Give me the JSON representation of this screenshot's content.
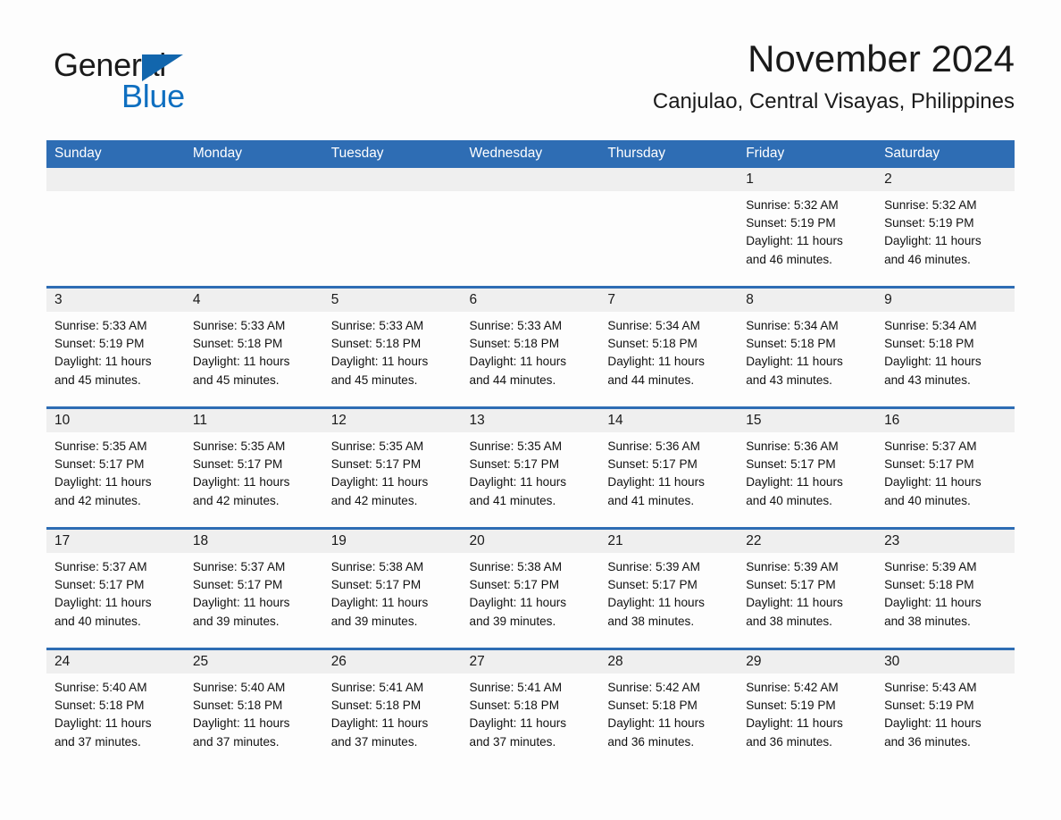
{
  "logo": {
    "word_one": "General",
    "word_two": "Blue",
    "triangle_color": "#1266ad",
    "blue_color": "#0f6fc0"
  },
  "header": {
    "month_title": "November 2024",
    "location": "Canjulao, Central Visayas, Philippines"
  },
  "theme": {
    "header_blue": "#2e6db4",
    "daynum_gray": "#efefef",
    "page_background": "#fdfdfd"
  },
  "weekday_headers": [
    "Sunday",
    "Monday",
    "Tuesday",
    "Wednesday",
    "Thursday",
    "Friday",
    "Saturday"
  ],
  "weeks": [
    [
      {
        "day": "",
        "empty": true
      },
      {
        "day": "",
        "empty": true
      },
      {
        "day": "",
        "empty": true
      },
      {
        "day": "",
        "empty": true
      },
      {
        "day": "",
        "empty": true
      },
      {
        "day": "1",
        "sunrise": "Sunrise: 5:32 AM",
        "sunset": "Sunset: 5:19 PM",
        "daylight_line1": "Daylight: 11 hours",
        "daylight_line2": "and 46 minutes."
      },
      {
        "day": "2",
        "sunrise": "Sunrise: 5:32 AM",
        "sunset": "Sunset: 5:19 PM",
        "daylight_line1": "Daylight: 11 hours",
        "daylight_line2": "and 46 minutes."
      }
    ],
    [
      {
        "day": "3",
        "sunrise": "Sunrise: 5:33 AM",
        "sunset": "Sunset: 5:19 PM",
        "daylight_line1": "Daylight: 11 hours",
        "daylight_line2": "and 45 minutes."
      },
      {
        "day": "4",
        "sunrise": "Sunrise: 5:33 AM",
        "sunset": "Sunset: 5:18 PM",
        "daylight_line1": "Daylight: 11 hours",
        "daylight_line2": "and 45 minutes."
      },
      {
        "day": "5",
        "sunrise": "Sunrise: 5:33 AM",
        "sunset": "Sunset: 5:18 PM",
        "daylight_line1": "Daylight: 11 hours",
        "daylight_line2": "and 45 minutes."
      },
      {
        "day": "6",
        "sunrise": "Sunrise: 5:33 AM",
        "sunset": "Sunset: 5:18 PM",
        "daylight_line1": "Daylight: 11 hours",
        "daylight_line2": "and 44 minutes."
      },
      {
        "day": "7",
        "sunrise": "Sunrise: 5:34 AM",
        "sunset": "Sunset: 5:18 PM",
        "daylight_line1": "Daylight: 11 hours",
        "daylight_line2": "and 44 minutes."
      },
      {
        "day": "8",
        "sunrise": "Sunrise: 5:34 AM",
        "sunset": "Sunset: 5:18 PM",
        "daylight_line1": "Daylight: 11 hours",
        "daylight_line2": "and 43 minutes."
      },
      {
        "day": "9",
        "sunrise": "Sunrise: 5:34 AM",
        "sunset": "Sunset: 5:18 PM",
        "daylight_line1": "Daylight: 11 hours",
        "daylight_line2": "and 43 minutes."
      }
    ],
    [
      {
        "day": "10",
        "sunrise": "Sunrise: 5:35 AM",
        "sunset": "Sunset: 5:17 PM",
        "daylight_line1": "Daylight: 11 hours",
        "daylight_line2": "and 42 minutes."
      },
      {
        "day": "11",
        "sunrise": "Sunrise: 5:35 AM",
        "sunset": "Sunset: 5:17 PM",
        "daylight_line1": "Daylight: 11 hours",
        "daylight_line2": "and 42 minutes."
      },
      {
        "day": "12",
        "sunrise": "Sunrise: 5:35 AM",
        "sunset": "Sunset: 5:17 PM",
        "daylight_line1": "Daylight: 11 hours",
        "daylight_line2": "and 42 minutes."
      },
      {
        "day": "13",
        "sunrise": "Sunrise: 5:35 AM",
        "sunset": "Sunset: 5:17 PM",
        "daylight_line1": "Daylight: 11 hours",
        "daylight_line2": "and 41 minutes."
      },
      {
        "day": "14",
        "sunrise": "Sunrise: 5:36 AM",
        "sunset": "Sunset: 5:17 PM",
        "daylight_line1": "Daylight: 11 hours",
        "daylight_line2": "and 41 minutes."
      },
      {
        "day": "15",
        "sunrise": "Sunrise: 5:36 AM",
        "sunset": "Sunset: 5:17 PM",
        "daylight_line1": "Daylight: 11 hours",
        "daylight_line2": "and 40 minutes."
      },
      {
        "day": "16",
        "sunrise": "Sunrise: 5:37 AM",
        "sunset": "Sunset: 5:17 PM",
        "daylight_line1": "Daylight: 11 hours",
        "daylight_line2": "and 40 minutes."
      }
    ],
    [
      {
        "day": "17",
        "sunrise": "Sunrise: 5:37 AM",
        "sunset": "Sunset: 5:17 PM",
        "daylight_line1": "Daylight: 11 hours",
        "daylight_line2": "and 40 minutes."
      },
      {
        "day": "18",
        "sunrise": "Sunrise: 5:37 AM",
        "sunset": "Sunset: 5:17 PM",
        "daylight_line1": "Daylight: 11 hours",
        "daylight_line2": "and 39 minutes."
      },
      {
        "day": "19",
        "sunrise": "Sunrise: 5:38 AM",
        "sunset": "Sunset: 5:17 PM",
        "daylight_line1": "Daylight: 11 hours",
        "daylight_line2": "and 39 minutes."
      },
      {
        "day": "20",
        "sunrise": "Sunrise: 5:38 AM",
        "sunset": "Sunset: 5:17 PM",
        "daylight_line1": "Daylight: 11 hours",
        "daylight_line2": "and 39 minutes."
      },
      {
        "day": "21",
        "sunrise": "Sunrise: 5:39 AM",
        "sunset": "Sunset: 5:17 PM",
        "daylight_line1": "Daylight: 11 hours",
        "daylight_line2": "and 38 minutes."
      },
      {
        "day": "22",
        "sunrise": "Sunrise: 5:39 AM",
        "sunset": "Sunset: 5:17 PM",
        "daylight_line1": "Daylight: 11 hours",
        "daylight_line2": "and 38 minutes."
      },
      {
        "day": "23",
        "sunrise": "Sunrise: 5:39 AM",
        "sunset": "Sunset: 5:18 PM",
        "daylight_line1": "Daylight: 11 hours",
        "daylight_line2": "and 38 minutes."
      }
    ],
    [
      {
        "day": "24",
        "sunrise": "Sunrise: 5:40 AM",
        "sunset": "Sunset: 5:18 PM",
        "daylight_line1": "Daylight: 11 hours",
        "daylight_line2": "and 37 minutes."
      },
      {
        "day": "25",
        "sunrise": "Sunrise: 5:40 AM",
        "sunset": "Sunset: 5:18 PM",
        "daylight_line1": "Daylight: 11 hours",
        "daylight_line2": "and 37 minutes."
      },
      {
        "day": "26",
        "sunrise": "Sunrise: 5:41 AM",
        "sunset": "Sunset: 5:18 PM",
        "daylight_line1": "Daylight: 11 hours",
        "daylight_line2": "and 37 minutes."
      },
      {
        "day": "27",
        "sunrise": "Sunrise: 5:41 AM",
        "sunset": "Sunset: 5:18 PM",
        "daylight_line1": "Daylight: 11 hours",
        "daylight_line2": "and 37 minutes."
      },
      {
        "day": "28",
        "sunrise": "Sunrise: 5:42 AM",
        "sunset": "Sunset: 5:18 PM",
        "daylight_line1": "Daylight: 11 hours",
        "daylight_line2": "and 36 minutes."
      },
      {
        "day": "29",
        "sunrise": "Sunrise: 5:42 AM",
        "sunset": "Sunset: 5:19 PM",
        "daylight_line1": "Daylight: 11 hours",
        "daylight_line2": "and 36 minutes."
      },
      {
        "day": "30",
        "sunrise": "Sunrise: 5:43 AM",
        "sunset": "Sunset: 5:19 PM",
        "daylight_line1": "Daylight: 11 hours",
        "daylight_line2": "and 36 minutes."
      }
    ]
  ]
}
